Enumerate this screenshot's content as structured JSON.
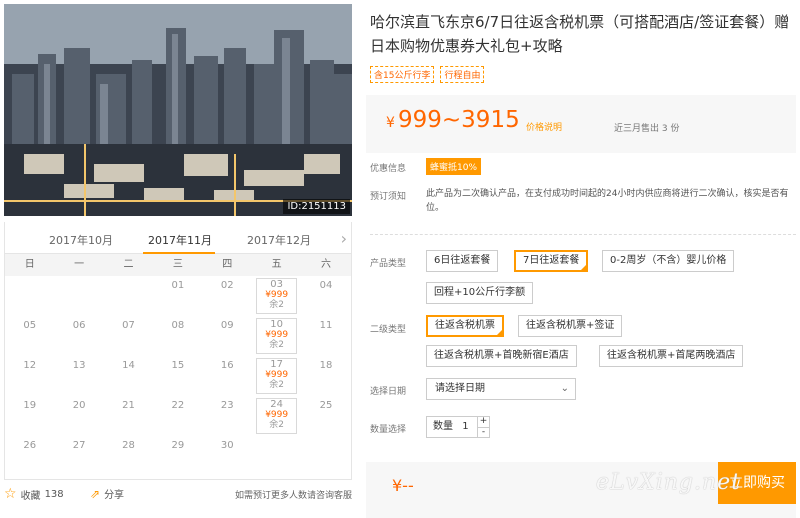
{
  "photo": {
    "id_label": "ID:2151113"
  },
  "calendar": {
    "months": [
      "2017年10月",
      "2017年11月",
      "2017年12月"
    ],
    "active_month_index": 1,
    "weekdays": [
      "日",
      "一",
      "二",
      "三",
      "四",
      "五",
      "六"
    ],
    "days": [
      {
        "d": ""
      },
      {
        "d": ""
      },
      {
        "d": ""
      },
      {
        "d": "01"
      },
      {
        "d": "02"
      },
      {
        "d": "03",
        "price": "¥999",
        "rem": "余2"
      },
      {
        "d": "04"
      },
      {
        "d": "05"
      },
      {
        "d": "06"
      },
      {
        "d": "07"
      },
      {
        "d": "08"
      },
      {
        "d": "09"
      },
      {
        "d": "10",
        "price": "¥999",
        "rem": "余2"
      },
      {
        "d": "11"
      },
      {
        "d": "12"
      },
      {
        "d": "13"
      },
      {
        "d": "14"
      },
      {
        "d": "15"
      },
      {
        "d": "16"
      },
      {
        "d": "17",
        "price": "¥999",
        "rem": "余2"
      },
      {
        "d": "18"
      },
      {
        "d": "19"
      },
      {
        "d": "20"
      },
      {
        "d": "21"
      },
      {
        "d": "22"
      },
      {
        "d": "23"
      },
      {
        "d": "24",
        "price": "¥999",
        "rem": "余2"
      },
      {
        "d": "25"
      },
      {
        "d": "26"
      },
      {
        "d": "27"
      },
      {
        "d": "28"
      },
      {
        "d": "29"
      },
      {
        "d": "30"
      },
      {
        "d": ""
      },
      {
        "d": ""
      }
    ]
  },
  "actions": {
    "favorite_label": "收藏",
    "favorite_count": "138",
    "share_label": "分享",
    "more_text": "如需预订更多人数请咨询客服"
  },
  "product": {
    "title": "哈尔滨直飞东京6/7日往返含税机票（可搭配酒店/签证套餐）赠日本购物优惠券大礼包+攻略",
    "tags": [
      "含15公斤行李",
      "行程自由"
    ],
    "currency": "¥",
    "price_range": "999~3915",
    "price_explain": "价格说明",
    "sold_text": "近三月售出 3 份"
  },
  "info": {
    "discount_label": "优惠信息",
    "discount_badge": "蜂蜜抵10%",
    "notice_label": "预订须知",
    "notice_text": "此产品为二次确认产品，在支付成功时间起的24小时内供应商将进行二次确认，核实是否有位。"
  },
  "options": {
    "type_label": "产品类型",
    "types": [
      "6日往返套餐",
      "7日往返套餐",
      "0-2周岁（不含）婴儿价格",
      "回程+10公斤行李额"
    ],
    "selected_type": 1,
    "sub_label": "二级类型",
    "subs": [
      "往返含税机票",
      "往返含税机票+签证",
      "往返含税机票+首晚新宿E酒店",
      "往返含税机票+首尾两晚酒店"
    ],
    "selected_sub": 0,
    "date_label": "选择日期",
    "date_placeholder": "请选择日期",
    "qty_label": "数量选择",
    "qty_prefix": "数量",
    "qty_value": "1"
  },
  "footer": {
    "total": "¥--",
    "buy_label": "立即购买"
  },
  "watermark": "eLvXing.net",
  "colors": {
    "accent": "#ff9900",
    "price": "#ff6600"
  }
}
